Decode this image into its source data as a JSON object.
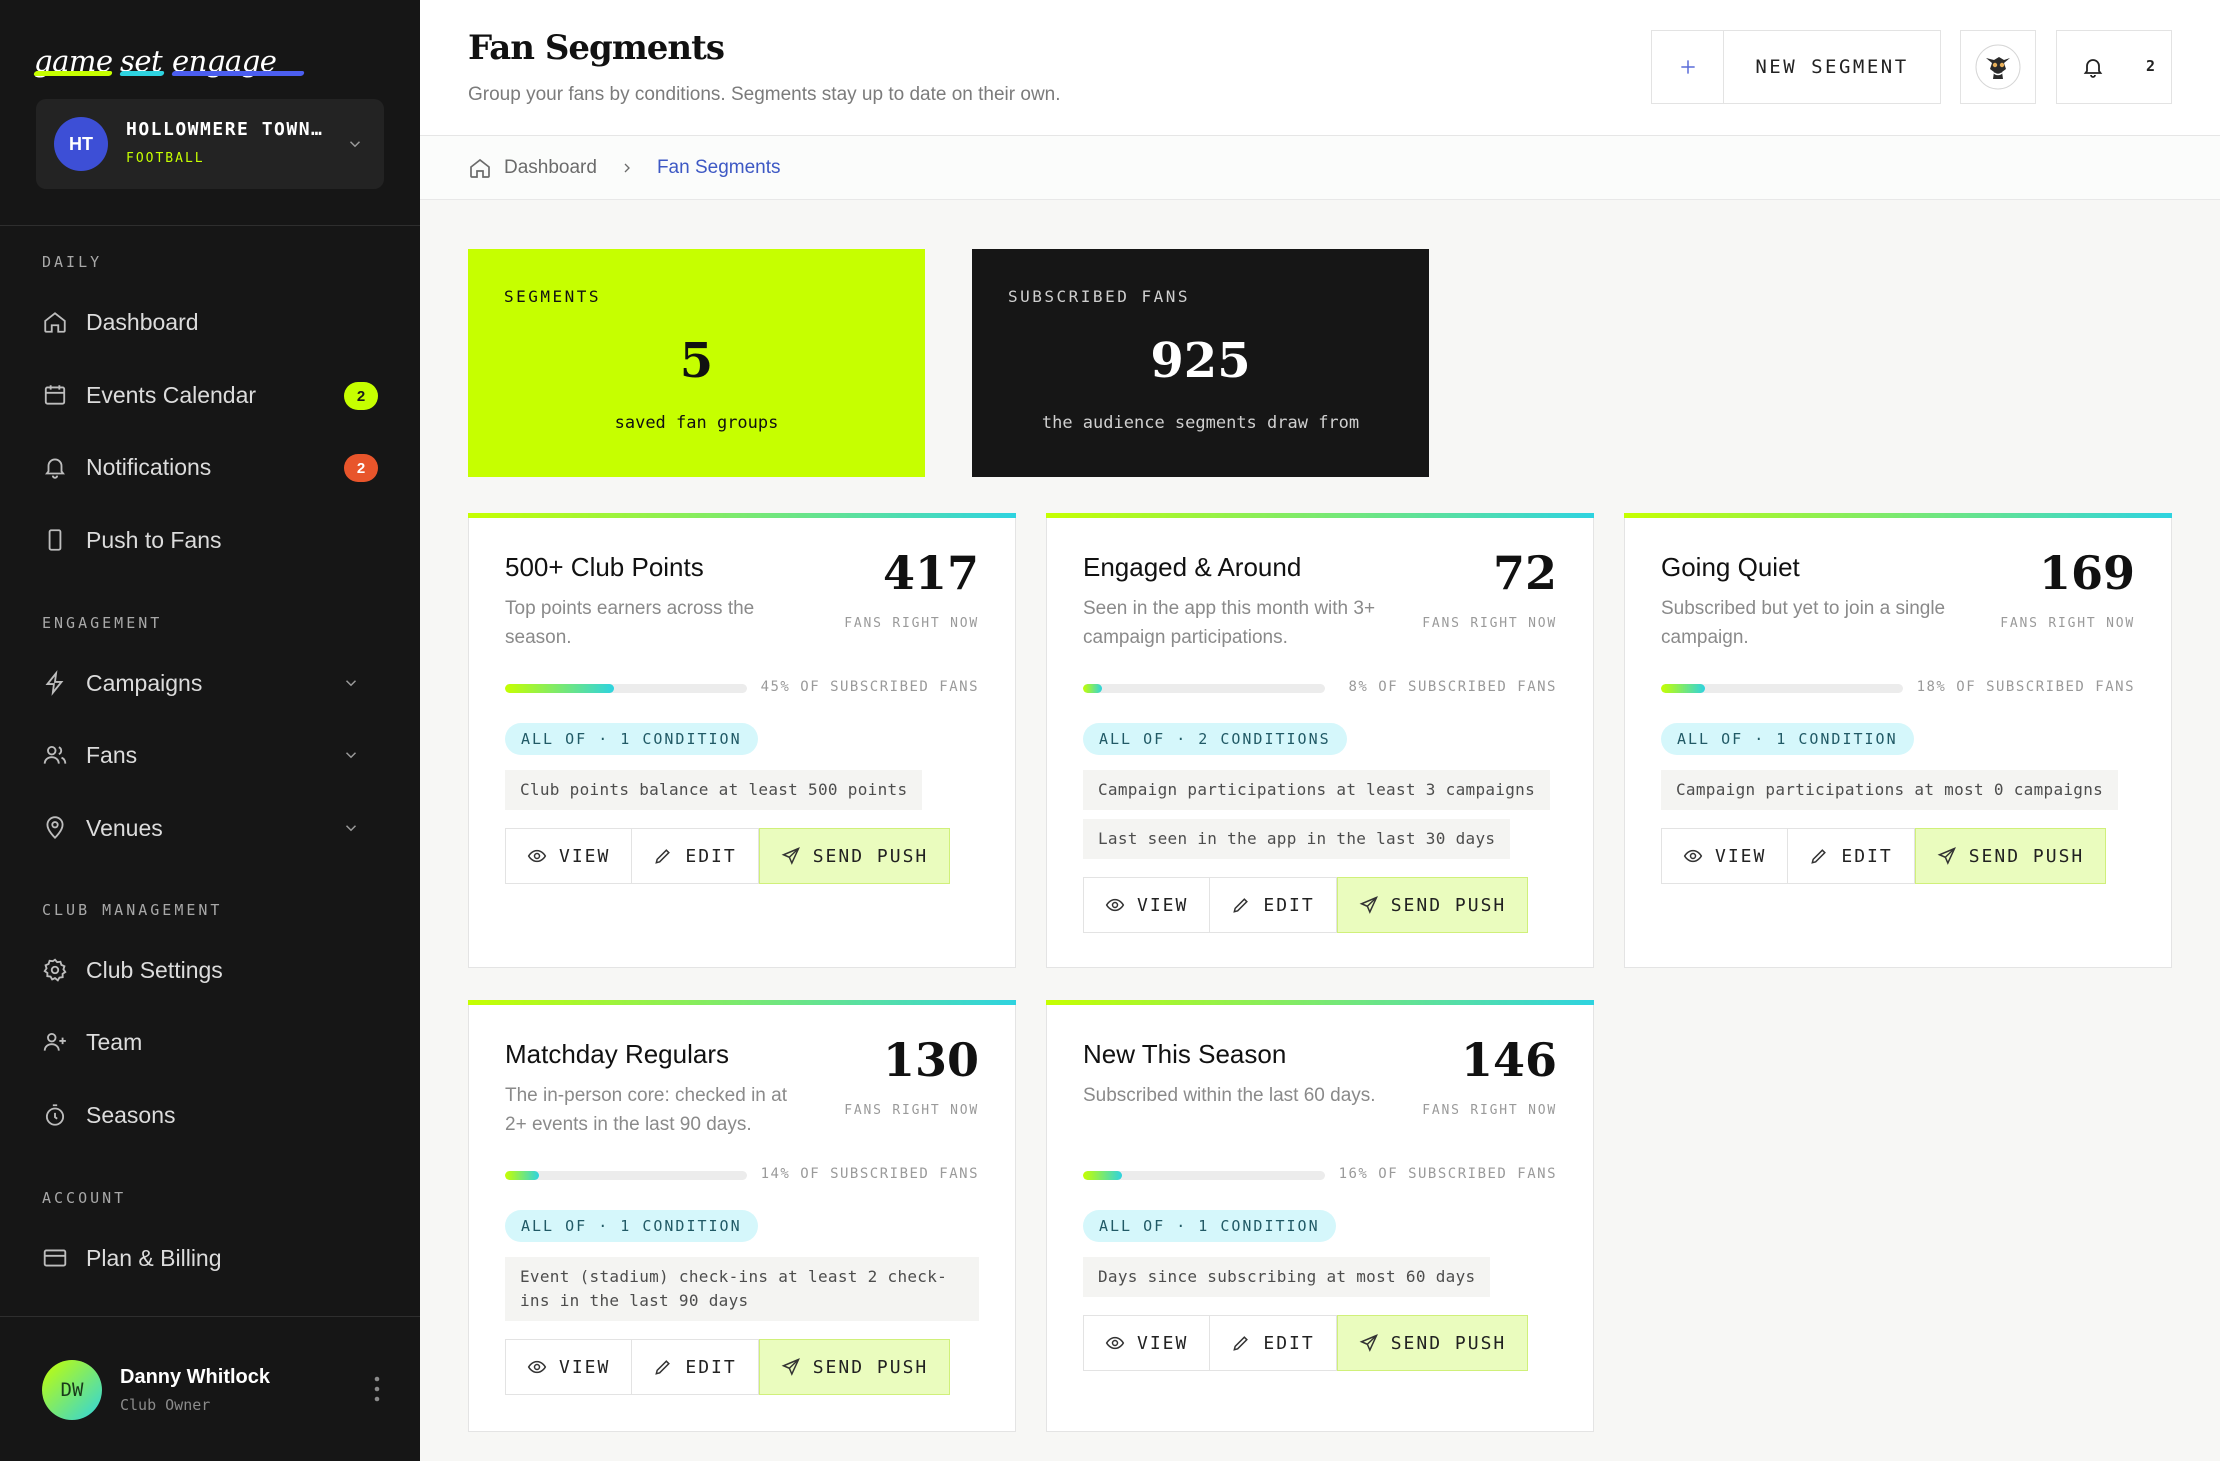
{
  "brand": {
    "words": [
      "game",
      "set",
      "engage"
    ]
  },
  "club": {
    "initials": "HT",
    "name": "HOLLOWMERE TOWN…",
    "sport": "FOOTBALL"
  },
  "sidebar": {
    "sections": [
      {
        "title": "DAILY",
        "items": [
          {
            "label": "Dashboard",
            "icon": "home-icon"
          },
          {
            "label": "Events Calendar",
            "icon": "calendar-icon",
            "badge": "2"
          },
          {
            "label": "Notifications",
            "icon": "bell-icon",
            "badge": "2"
          },
          {
            "label": "Push to Fans",
            "icon": "phone-icon"
          }
        ]
      },
      {
        "title": "ENGAGEMENT",
        "items": [
          {
            "label": "Campaigns",
            "icon": "lightning-icon"
          },
          {
            "label": "Fans",
            "icon": "users-icon"
          },
          {
            "label": "Venues",
            "icon": "map-pin-icon"
          }
        ]
      },
      {
        "title": "CLUB MANAGEMENT",
        "items": [
          {
            "label": "Club Settings",
            "icon": "gear-icon"
          },
          {
            "label": "Team",
            "icon": "user-plus-icon"
          },
          {
            "label": "Seasons",
            "icon": "stopwatch-icon"
          }
        ]
      },
      {
        "title": "ACCOUNT",
        "items": [
          {
            "label": "Plan & Billing",
            "icon": "credit-card-icon"
          }
        ]
      }
    ]
  },
  "user": {
    "initials": "DW",
    "name": "Danny Whitlock",
    "role": "Club Owner"
  },
  "header": {
    "title": "Fan Segments",
    "subtitle": "Group your fans by conditions. Segments stay up to date on their own.",
    "new_segment_label": "NEW SEGMENT",
    "notification_count": "2"
  },
  "breadcrumb": {
    "home": "Dashboard",
    "current": "Fan Segments"
  },
  "stats": [
    {
      "label": "SEGMENTS",
      "value": "5",
      "desc": "saved fan groups"
    },
    {
      "label": "SUBSCRIBED FANS",
      "value": "925",
      "desc": "the audience segments draw from"
    }
  ],
  "segments": [
    {
      "name": "500+ Club Points",
      "desc": "Top points earners across the season.",
      "count": "417",
      "count_label": "FANS RIGHT NOW",
      "share": 0.45,
      "share_label": "45% OF SUBSCRIBED FANS",
      "rule": "ALL OF · 1 CONDITION",
      "conditions": [
        "Club points balance at least 500 points"
      ]
    },
    {
      "name": "Engaged & Around",
      "desc": "Seen in the app this month with 3+ campaign participations.",
      "count": "72",
      "count_label": "FANS RIGHT NOW",
      "share": 0.08,
      "share_label": "8% OF SUBSCRIBED FANS",
      "rule": "ALL OF · 2 CONDITIONS",
      "conditions": [
        "Campaign participations at least 3 campaigns",
        "Last seen in the app in the last 30 days"
      ]
    },
    {
      "name": "Going Quiet",
      "desc": "Subscribed but yet to join a single campaign.",
      "count": "169",
      "count_label": "FANS RIGHT NOW",
      "share": 0.18,
      "share_label": "18% OF SUBSCRIBED FANS",
      "rule": "ALL OF · 1 CONDITION",
      "conditions": [
        "Campaign participations at most 0 campaigns"
      ]
    },
    {
      "name": "Matchday Regulars",
      "desc": "The in-person core: checked in at 2+ events in the last 90 days.",
      "count": "130",
      "count_label": "FANS RIGHT NOW",
      "share": 0.14,
      "share_label": "14% OF SUBSCRIBED FANS",
      "rule": "ALL OF · 1 CONDITION",
      "conditions": [
        "Event (stadium) check-ins at least 2 check-ins in the last 90 days"
      ]
    },
    {
      "name": "New This Season",
      "desc": "Subscribed within the last 60 days.",
      "count": "146",
      "count_label": "FANS RIGHT NOW",
      "share": 0.16,
      "share_label": "16% OF SUBSCRIBED FANS",
      "rule": "ALL OF · 1 CONDITION",
      "conditions": [
        "Days since subscribing at most 60 days"
      ]
    }
  ],
  "actions": {
    "view": "VIEW",
    "edit": "EDIT",
    "push": "SEND PUSH"
  },
  "colors": {
    "accent": "#c6ff00",
    "cyan": "#2ed3e0",
    "sidebar_bg": "#161616",
    "badge_red": "#e8552b",
    "link_blue": "#3d58c4"
  }
}
